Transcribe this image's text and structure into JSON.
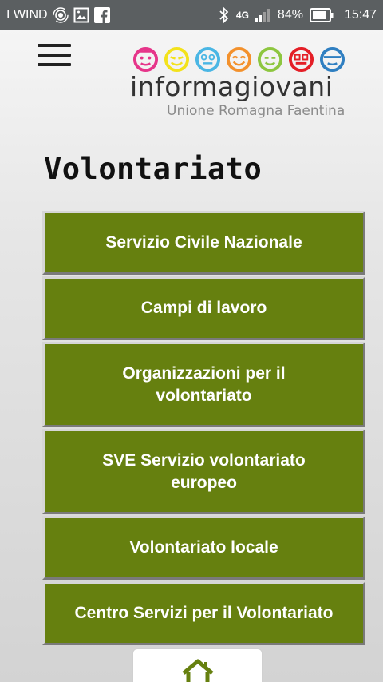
{
  "status_bar": {
    "carrier": "I WIND",
    "network": "4G",
    "battery": "84%",
    "time": "15:47",
    "icons": [
      "hotspot-icon",
      "image-icon",
      "facebook-icon",
      "bluetooth-icon",
      "signal-icon",
      "battery-icon"
    ]
  },
  "header": {
    "logo": {
      "brand": "informagiovani",
      "subtitle": "Unione Romagna Faentina",
      "face_colors": [
        "#e6358a",
        "#f3e21b",
        "#4ab6e4",
        "#f3912c",
        "#8dc63f",
        "#e41e26",
        "#2f7fc1"
      ]
    }
  },
  "page": {
    "title": "Volontariato"
  },
  "menu": {
    "accent": "#66800f",
    "items": [
      {
        "label": "Servizio Civile Nazionale"
      },
      {
        "label": "Campi di lavoro"
      },
      {
        "label": "Organizzazioni per il volontariato"
      },
      {
        "label": "SVE Servizio volontariato europeo"
      },
      {
        "label": "Volontariato locale"
      },
      {
        "label": "Centro Servizi per il Volontariato"
      }
    ]
  },
  "bottom": {
    "home_icon": "home-icon"
  }
}
